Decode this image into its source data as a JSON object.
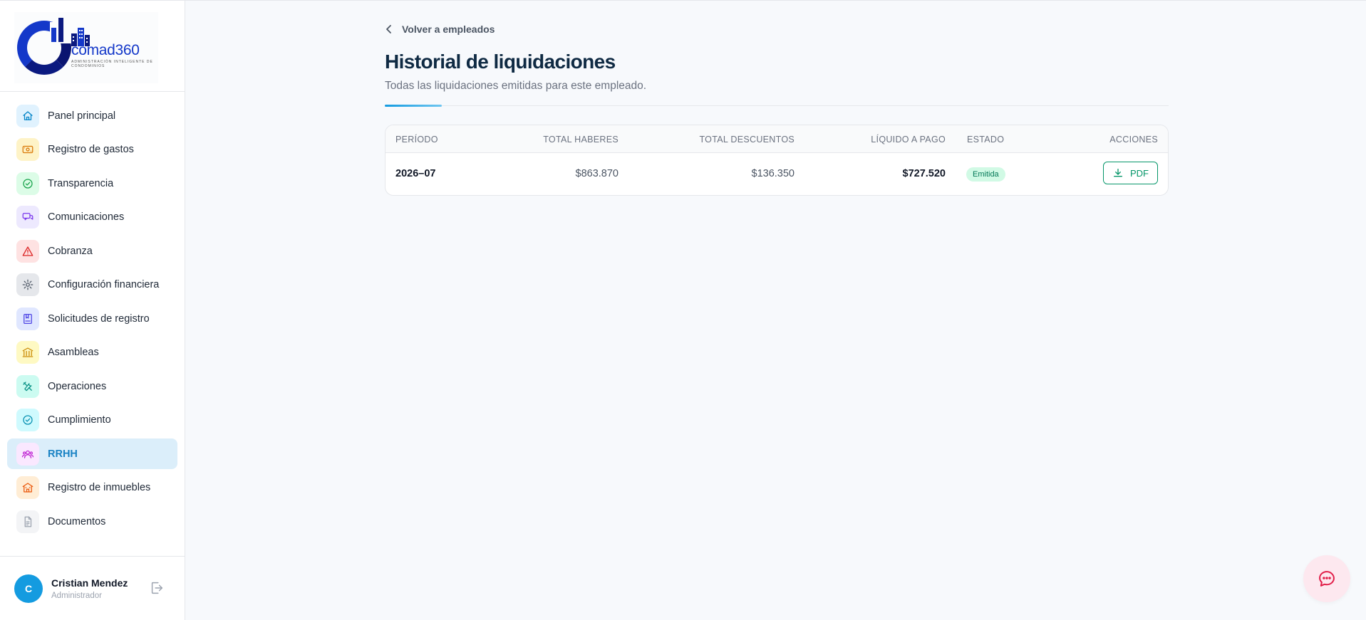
{
  "logo": {
    "brand": "comad360",
    "tagline": "Administración inteligente de condominios"
  },
  "sidebar": {
    "items": [
      {
        "label": "Panel principal",
        "icon": "home-icon",
        "bg": "#e0f2fe",
        "fg": "#0284c7"
      },
      {
        "label": "Registro de gastos",
        "icon": "money-icon",
        "bg": "#fef3c7",
        "fg": "#d97706"
      },
      {
        "label": "Transparencia",
        "icon": "check-circle-icon",
        "bg": "#dcfce7",
        "fg": "#16a34a"
      },
      {
        "label": "Comunicaciones",
        "icon": "chat-icon",
        "bg": "#ede9fe",
        "fg": "#7c3aed"
      },
      {
        "label": "Cobranza",
        "icon": "alert-triangle-icon",
        "bg": "#fee2e2",
        "fg": "#dc2626"
      },
      {
        "label": "Configuración financiera",
        "icon": "gear-icon",
        "bg": "#e5e7eb",
        "fg": "#4b5563"
      },
      {
        "label": "Solicitudes de registro",
        "icon": "book-icon",
        "bg": "#e0e7ff",
        "fg": "#4f46e5"
      },
      {
        "label": "Asambleas",
        "icon": "bank-icon",
        "bg": "#fef9c3",
        "fg": "#ca8a04"
      },
      {
        "label": "Operaciones",
        "icon": "tools-icon",
        "bg": "#ccfbf1",
        "fg": "#0d9488"
      },
      {
        "label": "Cumplimiento",
        "icon": "check-circle-icon",
        "bg": "#cffafe",
        "fg": "#0891b2"
      },
      {
        "label": "RRHH",
        "icon": "users-icon",
        "bg": "#fae8ff",
        "fg": "#c026d3"
      },
      {
        "label": "Registro de inmuebles",
        "icon": "building-icon",
        "bg": "#ffedd5",
        "fg": "#ea580c"
      },
      {
        "label": "Documentos",
        "icon": "document-icon",
        "bg": "#f3f4f6",
        "fg": "#9ca3af"
      }
    ],
    "active_index": 10
  },
  "user": {
    "initial": "C",
    "name": "Cristian Mendez",
    "role": "Administrador"
  },
  "main": {
    "back_label": "Volver a empleados",
    "title": "Historial de liquidaciones",
    "subtitle": "Todas las liquidaciones emitidas para este empleado."
  },
  "table": {
    "headers": [
      "PERÍODO",
      "TOTAL HABERES",
      "TOTAL DESCUENTOS",
      "LÍQUIDO A PAGO",
      "ESTADO",
      "ACCIONES"
    ],
    "rows": [
      {
        "periodo": "2026–07",
        "haberes": "$863.870",
        "descuentos": "$136.350",
        "liquido": "$727.520",
        "estado": "Emitida",
        "accion": "PDF"
      }
    ]
  },
  "colors": {
    "accent": "#149be0",
    "title": "#0f2a43",
    "success": "#059669"
  }
}
